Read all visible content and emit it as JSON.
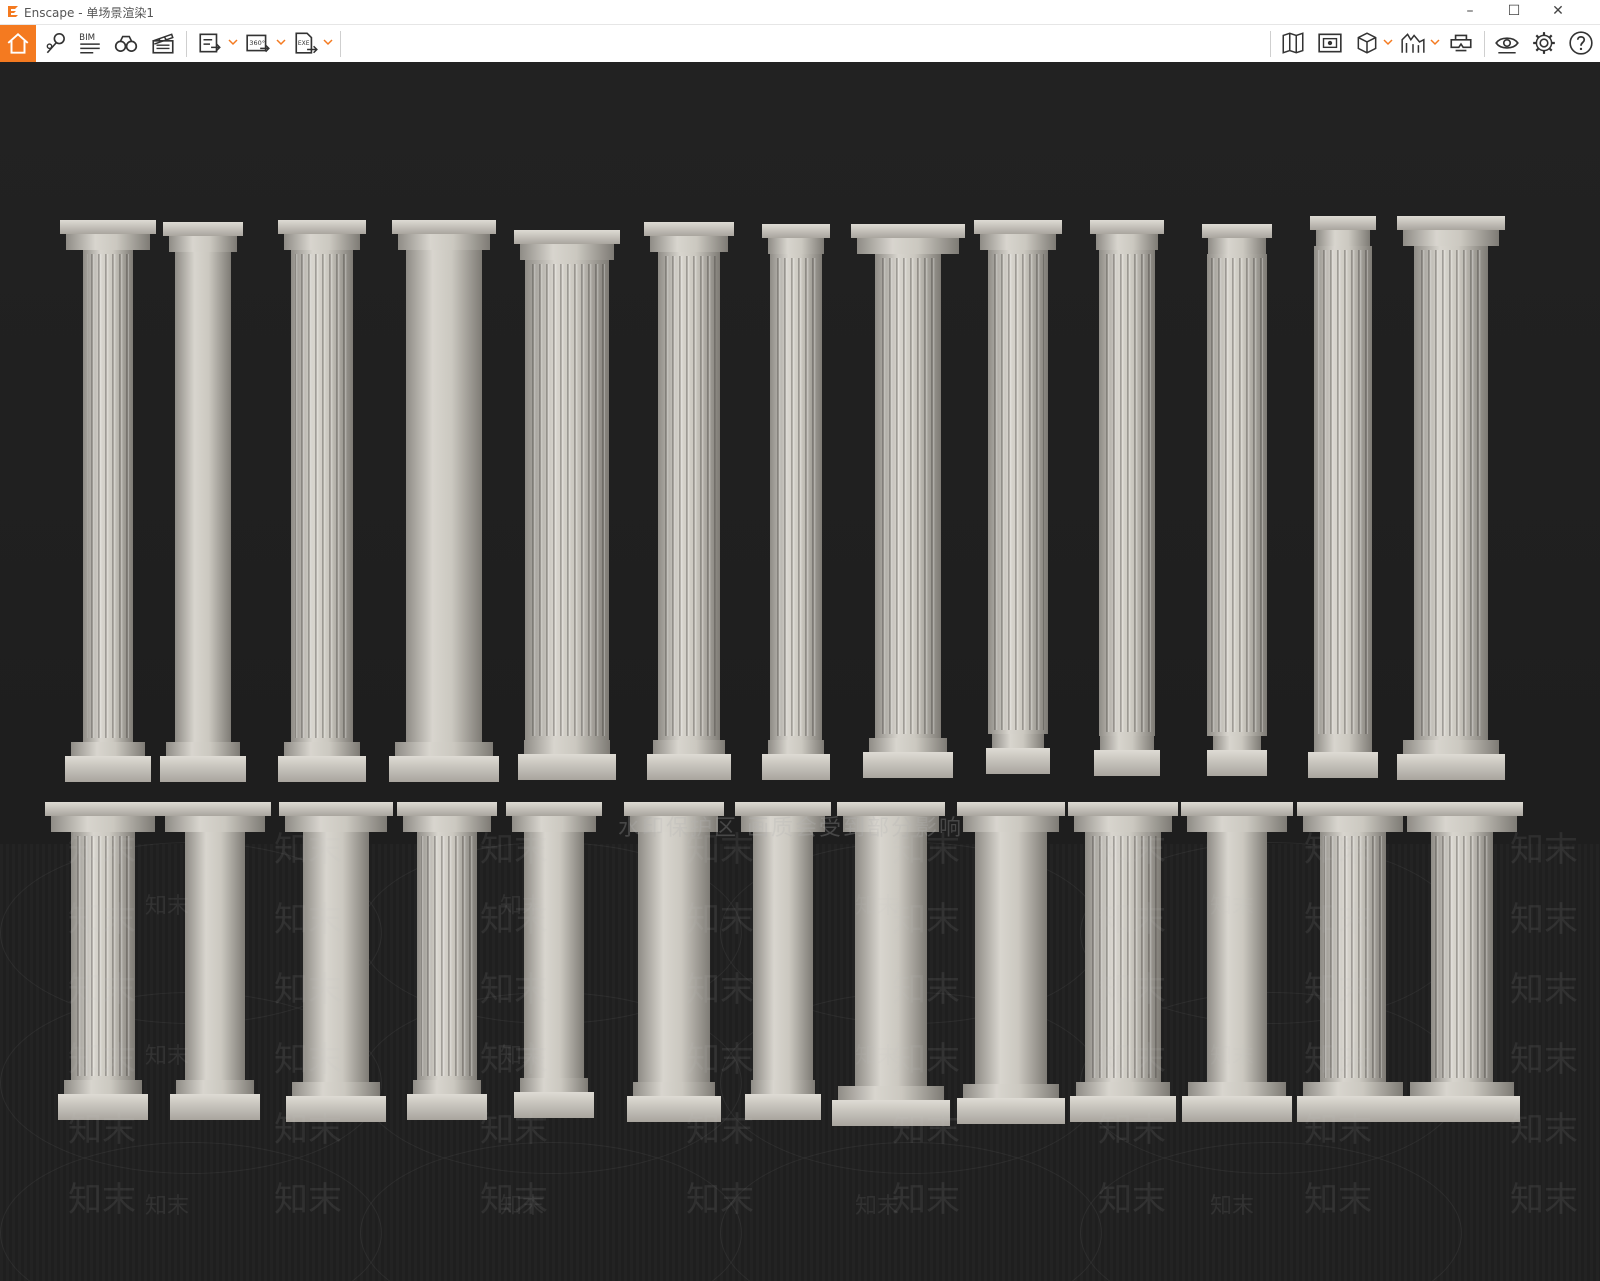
{
  "window": {
    "title": "Enscape - 单场景渲染1",
    "minimize": "–",
    "maximize": "☐",
    "close": "✕"
  },
  "toolbar": {
    "bim_label": "BIM",
    "panorama_label": "360°",
    "exe_label": "EXE",
    "accent_color": "#f47a20",
    "left_icons": [
      "home-icon",
      "locations-icon",
      "bim-icon",
      "binoculars-icon",
      "clapperboard-icon",
      "render-export-icon",
      "panorama-export-icon",
      "exe-export-icon"
    ],
    "right_icons": [
      "map-icon",
      "screenshot-view-icon",
      "cube-view-icon",
      "mountains-icon",
      "vr-headset-icon",
      "visibility-icon",
      "settings-icon",
      "help-icon"
    ]
  },
  "viewport": {
    "watermark_text": "知末",
    "watermark_notice": "水印保护区 画质会受到部分影响"
  }
}
